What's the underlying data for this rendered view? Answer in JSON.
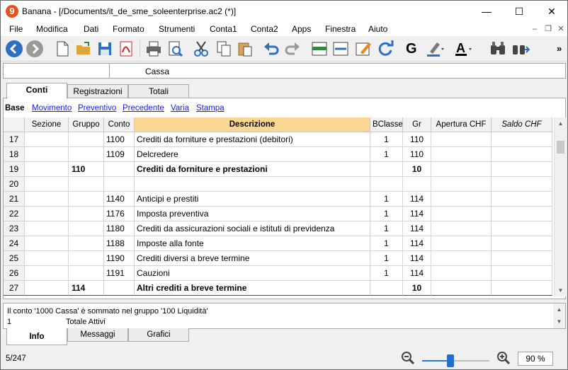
{
  "titlebar": {
    "logo": "9",
    "title": "Banana - [/Documents/it_de_sme_soleenterprise.ac2 (*)]",
    "minimize": "—",
    "maximize": "☐",
    "close": "✕"
  },
  "menu": [
    "File",
    "Modifica",
    "Dati",
    "Formato",
    "Strumenti",
    "Conta1",
    "Conta2",
    "Apps",
    "Finestra",
    "Aiuto"
  ],
  "toolbar": {
    "bold_label": "G",
    "more": "»"
  },
  "cellbar": {
    "content": "Cassa"
  },
  "tabs": [
    "Conti",
    "Registrazioni",
    "Totali"
  ],
  "views": [
    "Base",
    "Movimento",
    "Preventivo",
    "Precedente",
    "Varia",
    "Stampa"
  ],
  "columns": [
    "",
    "Sezione",
    "Gruppo",
    "Conto",
    "Descrizione",
    "BClasse",
    "Gr",
    "Apertura CHF",
    "Saldo CHF"
  ],
  "rows": [
    {
      "n": "17",
      "sezione": "",
      "gruppo": "",
      "conto": "1100",
      "descrizione": "Crediti da forniture e prestazioni (debitori)",
      "bclasse": "1",
      "gr": "110",
      "bold": false
    },
    {
      "n": "18",
      "sezione": "",
      "gruppo": "",
      "conto": "1109",
      "descrizione": "Delcredere",
      "bclasse": "1",
      "gr": "110",
      "bold": false
    },
    {
      "n": "19",
      "sezione": "",
      "gruppo": "110",
      "conto": "",
      "descrizione": "Crediti da forniture e prestazioni",
      "bclasse": "",
      "gr": "10",
      "bold": true
    },
    {
      "n": "20",
      "sezione": "",
      "gruppo": "",
      "conto": "",
      "descrizione": "",
      "bclasse": "",
      "gr": "",
      "bold": false
    },
    {
      "n": "21",
      "sezione": "",
      "gruppo": "",
      "conto": "1140",
      "descrizione": "Anticipi e prestiti",
      "bclasse": "1",
      "gr": "114",
      "bold": false
    },
    {
      "n": "22",
      "sezione": "",
      "gruppo": "",
      "conto": "1176",
      "descrizione": "Imposta preventiva",
      "bclasse": "1",
      "gr": "114",
      "bold": false
    },
    {
      "n": "23",
      "sezione": "",
      "gruppo": "",
      "conto": "1180",
      "descrizione": "Crediti da assicurazioni sociali e istituti di previdenza",
      "bclasse": "1",
      "gr": "114",
      "bold": false
    },
    {
      "n": "24",
      "sezione": "",
      "gruppo": "",
      "conto": "1188",
      "descrizione": "Imposte alla fonte",
      "bclasse": "1",
      "gr": "114",
      "bold": false
    },
    {
      "n": "25",
      "sezione": "",
      "gruppo": "",
      "conto": "1190",
      "descrizione": "Crediti diversi a breve termine",
      "bclasse": "1",
      "gr": "114",
      "bold": false
    },
    {
      "n": "26",
      "sezione": "",
      "gruppo": "",
      "conto": "1191",
      "descrizione": "Cauzioni",
      "bclasse": "1",
      "gr": "114",
      "bold": false
    },
    {
      "n": "27",
      "sezione": "",
      "gruppo": "114",
      "conto": "",
      "descrizione": "Altri crediti a breve termine",
      "bclasse": "",
      "gr": "10",
      "bold": true
    }
  ],
  "info": {
    "line1": "Il conto '1000 Cassa' è sommato nel gruppo '100 Liquidità'",
    "line2_num": "1",
    "line2_text": "Totale Attivi"
  },
  "bottom_tabs": [
    "Info",
    "Messaggi",
    "Grafici"
  ],
  "status": {
    "position": "5/247",
    "zoom": "90 %",
    "zoom_level": 0.42
  },
  "colors": {
    "description_header": "#fbd691",
    "link": "#1a1aee",
    "accent": "#2a7ad1"
  }
}
